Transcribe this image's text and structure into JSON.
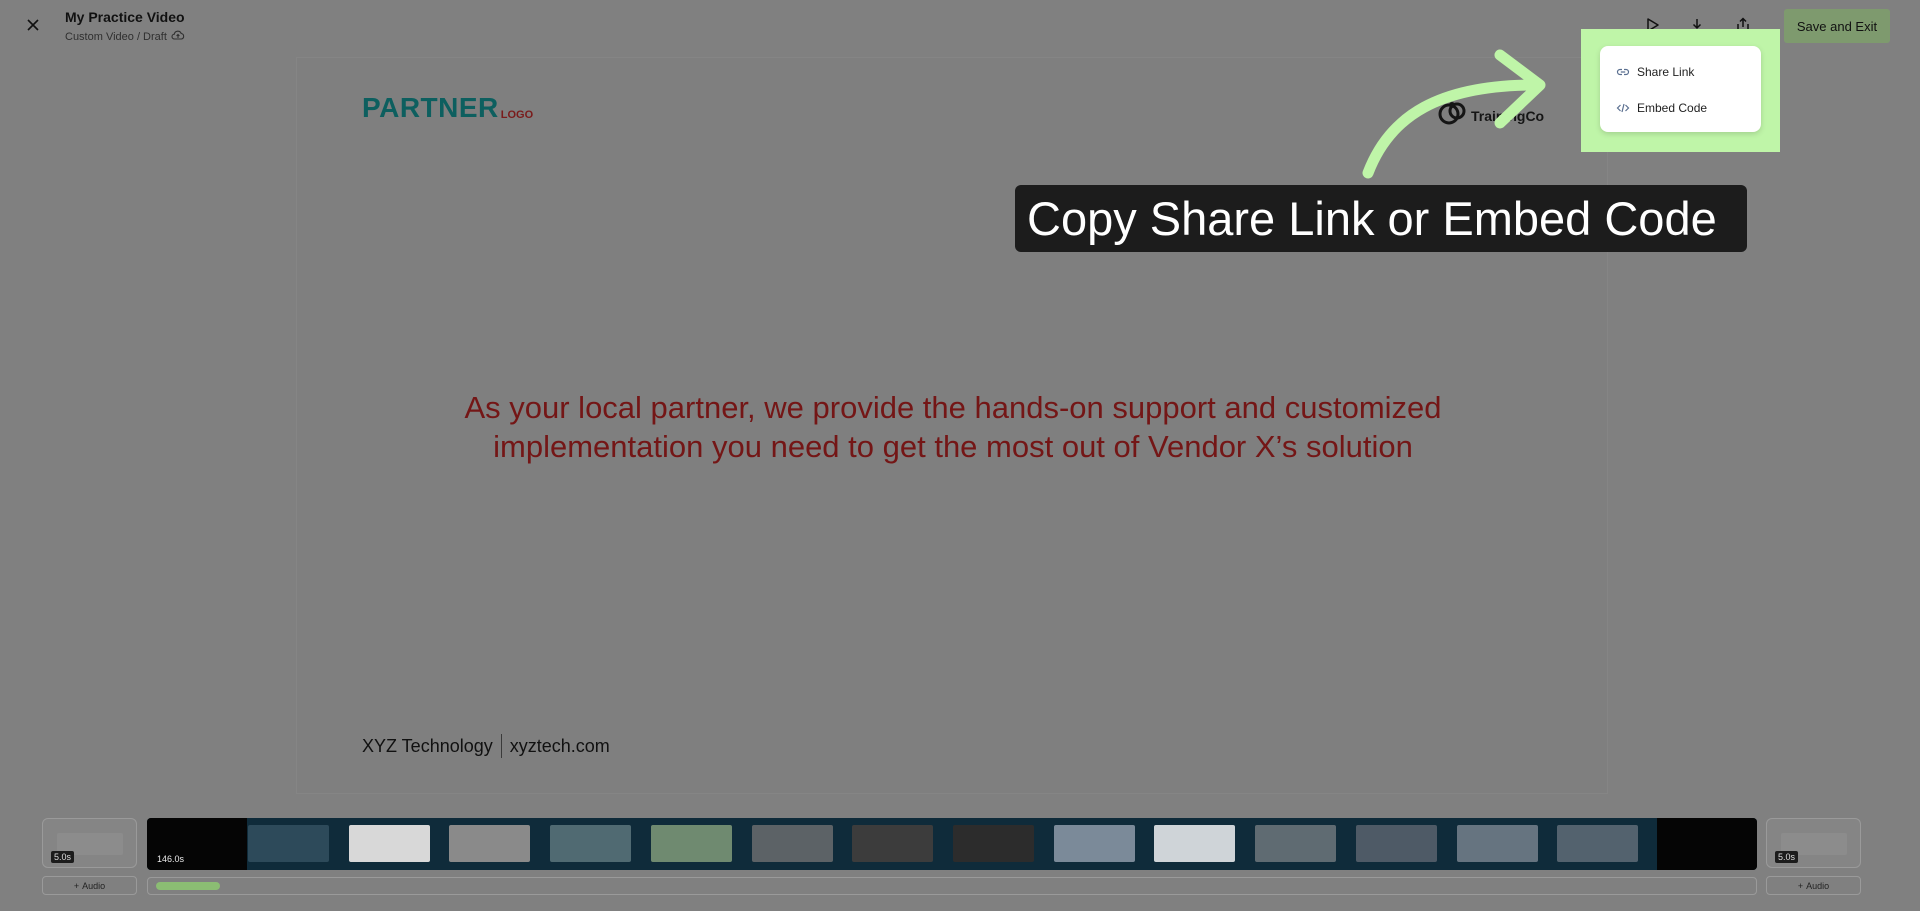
{
  "header": {
    "title": "My Practice Video",
    "subtitle": "Custom Video / Draft",
    "save_exit_label": "Save and Exit",
    "icons": [
      "close-icon",
      "cloud-upload-icon",
      "play-icon",
      "download-icon",
      "share-icon"
    ]
  },
  "slide": {
    "partner_logo_main": "PARTNER",
    "partner_logo_sub": "LOGO",
    "trainingco_label": "TrainingCo",
    "body_line1": "As your local partner, we provide the hands-on support and customized",
    "body_line2": "implementation you need to get the most out of Vendor X’s solution",
    "footer_company": "XYZ Technology",
    "footer_website": "xyztech.com"
  },
  "share_menu": {
    "items": [
      {
        "label": "Share Link",
        "icon": "link-icon"
      },
      {
        "label": "Embed Code",
        "icon": "code-icon"
      }
    ]
  },
  "callout": {
    "text": "Copy Share Link or Embed Code",
    "highlight_color": "#bff5a8"
  },
  "timeline": {
    "left_clip_duration": "5.0s",
    "main_clip_duration": "146.0s",
    "right_clip_duration": "5.0s",
    "audio_label": "Audio",
    "progress_fraction": 0.04,
    "frame_count": 14
  }
}
